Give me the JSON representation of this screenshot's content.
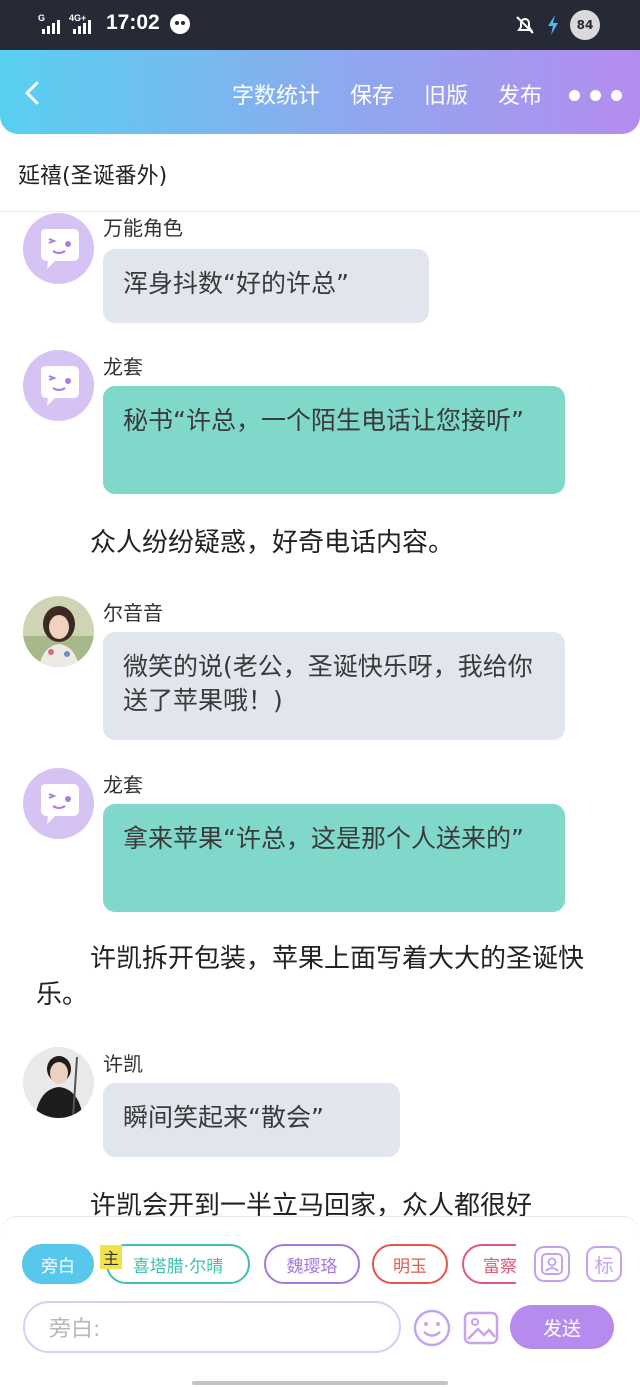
{
  "status_bar": {
    "time": "17:02",
    "signal1": "G",
    "signal2": "4G+",
    "battery": "84",
    "icons": [
      "signal-icon",
      "app-icon",
      "mute-icon",
      "charging-icon",
      "battery-icon"
    ]
  },
  "nav": {
    "back_icon": "chevron-left-icon",
    "links": [
      "字数统计",
      "保存",
      "旧版",
      "发布"
    ],
    "more_icon": "more-dots-icon"
  },
  "document": {
    "title": "延禧(圣诞番外)"
  },
  "messages": [
    {
      "type": "dialog",
      "speaker": "万能角色",
      "text": "浑身抖数“好的许总”",
      "bubble": "gray",
      "avatar": "default-avatar-icon"
    },
    {
      "type": "dialog",
      "speaker": "龙套",
      "text": "秘书“许总，一个陌生电话让您接听”",
      "bubble": "teal",
      "avatar": "default-avatar-icon"
    },
    {
      "type": "narration",
      "text": "众人纷纷疑惑，好奇电话内容。"
    },
    {
      "type": "dialog",
      "speaker": "尔音音",
      "text": "微笑的说(老公，圣诞快乐呀，我给你送了苹果哦！)",
      "bubble": "gray",
      "avatar": "photo-avatar-woman"
    },
    {
      "type": "dialog",
      "speaker": "龙套",
      "text": "拿来苹果“许总，这是那个人送来的”",
      "bubble": "teal",
      "avatar": "default-avatar-icon"
    },
    {
      "type": "narration",
      "text": "许凯拆开包装，苹果上面写着大大的圣诞快乐。"
    },
    {
      "type": "dialog",
      "speaker": "许凯",
      "text": "瞬间笑起来“散会”",
      "bubble": "gray",
      "avatar": "photo-avatar-man"
    },
    {
      "type": "narration",
      "text": "许凯会开到一半立马回家，众人都很好"
    }
  ],
  "characters": {
    "tag": "主",
    "chips": [
      {
        "label": "旁白",
        "color": "#57c8ec",
        "active": true
      },
      {
        "label": "喜塔腊·尔晴",
        "color": "#3fbfae",
        "active": false
      },
      {
        "label": "魏璎珞",
        "color": "#a47bdc",
        "active": false
      },
      {
        "label": "明玉",
        "color": "#e0584f",
        "active": false
      },
      {
        "label": "富察",
        "color": "#e05a7a",
        "active": false
      }
    ],
    "profile_icon": "person-card-icon",
    "tag_button": "标"
  },
  "composer": {
    "placeholder": "旁白:",
    "emoji_icon": "smiley-icon",
    "image_icon": "image-icon",
    "send": "发送"
  },
  "colors": {
    "nav_gradient": [
      "#57d0f0",
      "#b48cef"
    ],
    "teal_bubble": "#80d8cb",
    "gray_bubble": "#e1e6ee",
    "accent": "#b58bee"
  }
}
